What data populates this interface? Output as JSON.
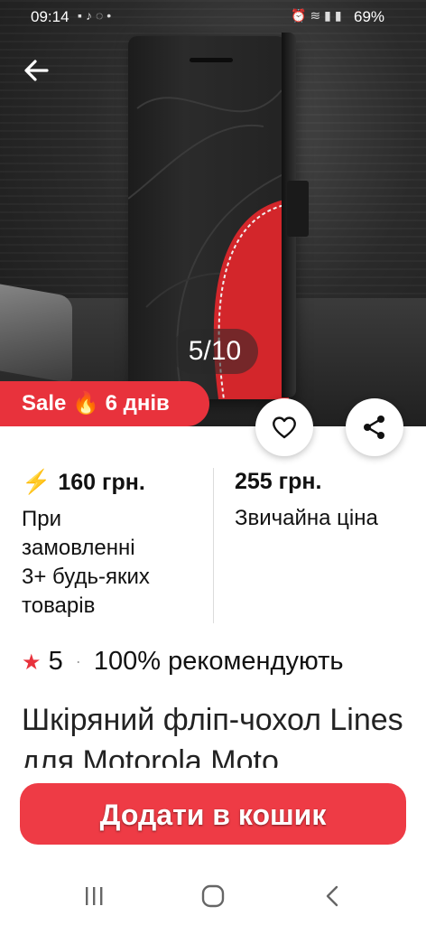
{
  "status_bar": {
    "time": "09:14",
    "battery": "69%",
    "left_icons": [
      "facebook-icon",
      "tiktok-icon",
      "viber-icon",
      "dot"
    ],
    "right_icons": [
      "alarm-icon",
      "wifi-icon",
      "signal-icon",
      "signal-icon"
    ]
  },
  "gallery": {
    "counter": "5/10"
  },
  "sale_badge": {
    "text": "Sale 🔥 6 днів"
  },
  "prices": {
    "bulk_price": "160 грн.",
    "bulk_note_lines": [
      "При",
      "замовленні",
      "3+ будь-яких",
      "товарів"
    ],
    "regular_price": "255 грн.",
    "regular_note": "Звичайна ціна"
  },
  "rating": {
    "score": "5",
    "recommend": "100% рекомендують"
  },
  "product": {
    "title": "Шкіряний фліп-чохол Lines для Motorola Moto"
  },
  "actions": {
    "add_to_cart": "Додати в кошик"
  },
  "colors": {
    "accent": "#ee3b45",
    "sale_badge": "#e8323c"
  }
}
